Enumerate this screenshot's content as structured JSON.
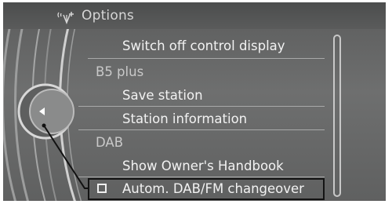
{
  "header": {
    "title": "Options",
    "icon": "radio-settings-icon"
  },
  "menu": {
    "switch_off_display": "Switch off control display",
    "section_b5": "B5 plus",
    "save_station": "Save station",
    "station_information": "Station information",
    "section_dab": "DAB",
    "show_handbook": "Show Owner's Handbook",
    "autom_changeover": "Autom. DAB/FM changeover"
  },
  "controller": {
    "icon": "controller-knob-left-arrow-icon"
  },
  "colors": {
    "screen_bg": "#6a6b6b",
    "text_primary": "#f2f2f2",
    "text_secondary": "#c9c9c9",
    "highlight_border": "#141414"
  }
}
